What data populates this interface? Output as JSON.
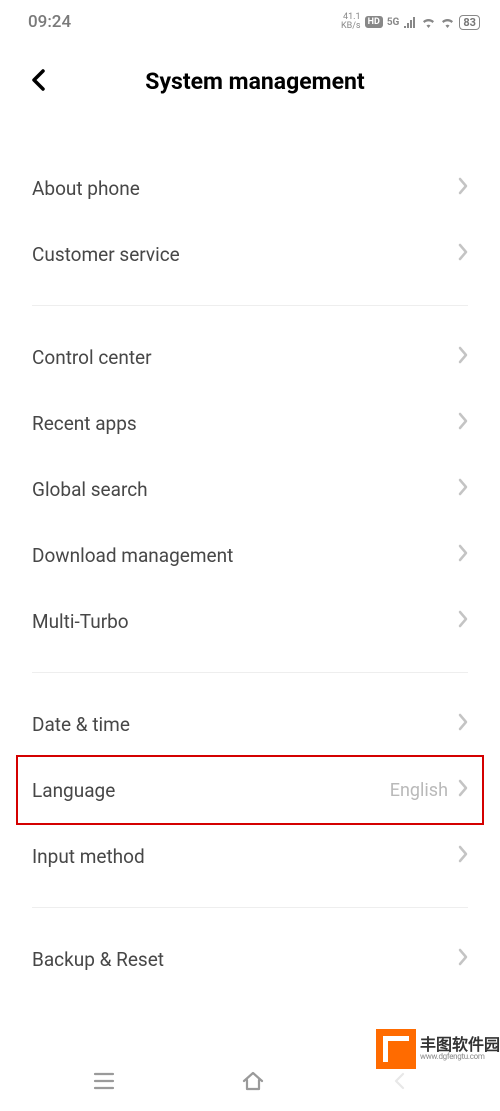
{
  "status": {
    "time": "09:24",
    "speed_value": "41.1",
    "speed_unit": "KB/s",
    "hd": "HD",
    "network": "5G",
    "battery": "83"
  },
  "header": {
    "title": "System management"
  },
  "groups": [
    {
      "items": [
        {
          "label": "About phone",
          "value": ""
        },
        {
          "label": "Customer service",
          "value": ""
        }
      ]
    },
    {
      "items": [
        {
          "label": "Control center",
          "value": ""
        },
        {
          "label": "Recent apps",
          "value": ""
        },
        {
          "label": "Global search",
          "value": ""
        },
        {
          "label": "Download management",
          "value": ""
        },
        {
          "label": "Multi-Turbo",
          "value": ""
        }
      ]
    },
    {
      "items": [
        {
          "label": "Date & time",
          "value": ""
        },
        {
          "label": "Language",
          "value": "English",
          "highlighted": true
        },
        {
          "label": "Input method",
          "value": ""
        }
      ]
    },
    {
      "items": [
        {
          "label": "Backup & Reset",
          "value": ""
        }
      ]
    }
  ],
  "watermark": {
    "text": "丰图软件园",
    "url": "www.dgfengtu.com"
  }
}
